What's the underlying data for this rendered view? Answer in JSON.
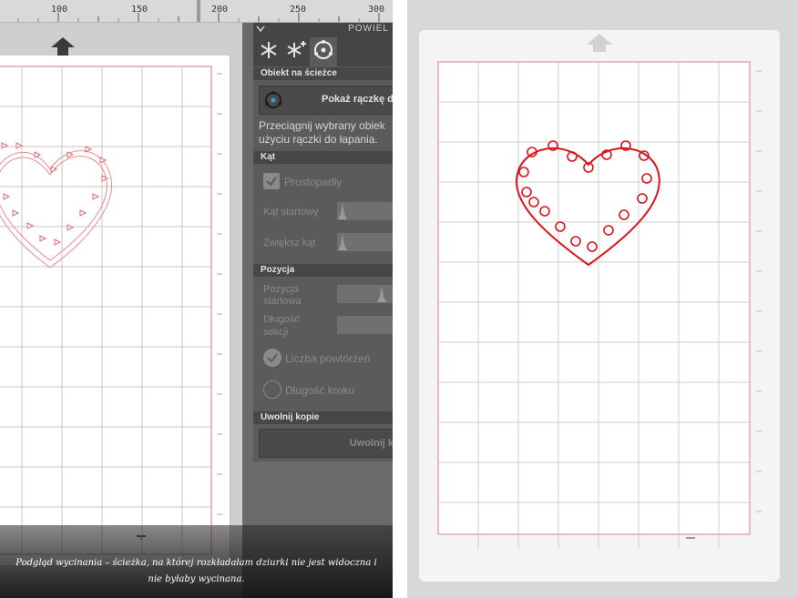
{
  "ruler": {
    "ticks": [
      "100",
      "150",
      "200",
      "250",
      "300"
    ]
  },
  "panel": {
    "title": "POWIEL",
    "section_path": "Obiekt na ścieżce",
    "show_handle_button": "Pokaż rączkę d",
    "instructions_line1": "Przeciągnij wybrany obiek",
    "instructions_line2": "użyciu rączki do łapania.",
    "section_angle": "Kąt",
    "perpendicular": "Prostopadły",
    "start_angle": "Kąt startowy",
    "increase_angle": "Zwiększ kąt",
    "section_position": "Pozycja",
    "start_position_l1": "Pozycja",
    "start_position_l2": "startowa",
    "section_length_l1": "Długość",
    "section_length_l2": "sekcji",
    "repeat_count": "Liczba powtórzeń",
    "step_length": "Długość kroku",
    "section_release": "Uwolnij kopie",
    "release_button": "Uwolnij k"
  },
  "caption": {
    "line1": "Podgląd wycinania – ścieżka, na której rozkładałam dziurki nie jest widoczna i",
    "line2": "nie byłaby wycinana."
  },
  "colors": {
    "cut_red": "#d9141c",
    "panel_dark": "#5b5b5b",
    "mat_grey": "#cfcfcf"
  }
}
